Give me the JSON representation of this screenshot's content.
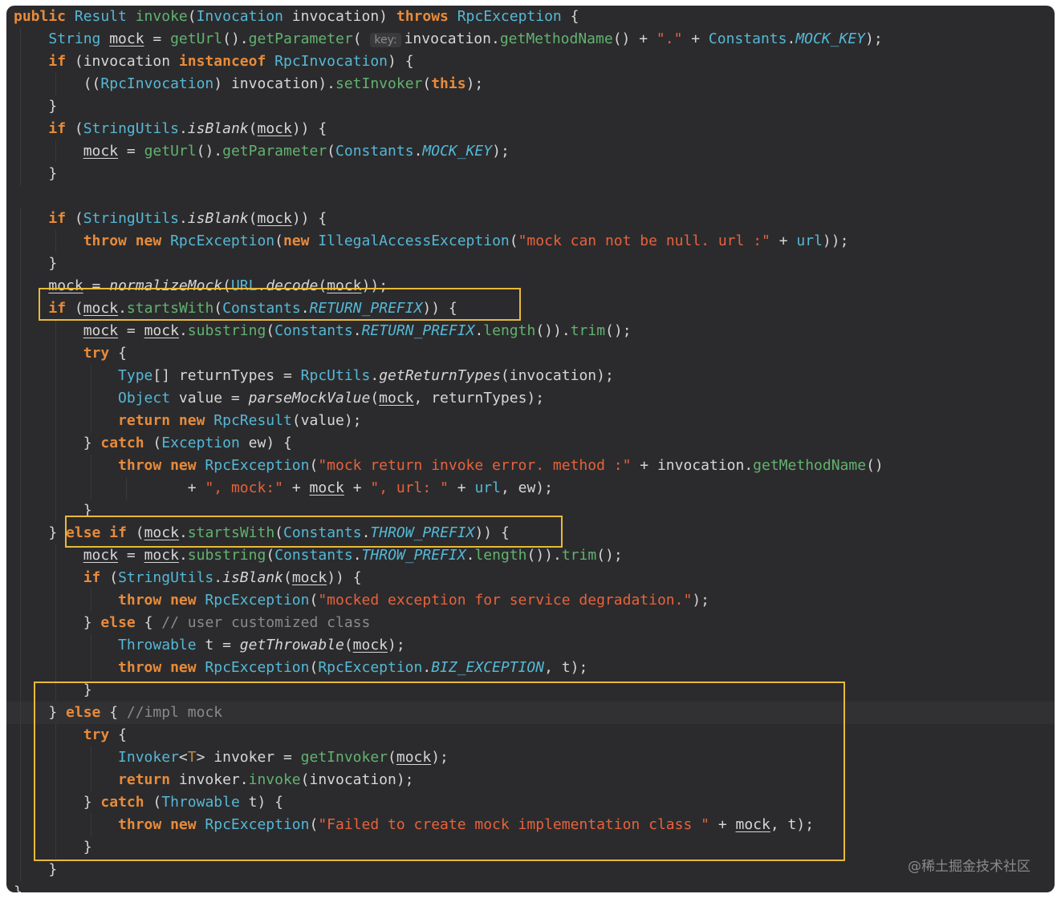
{
  "colors": {
    "keyword": "#e88b3a",
    "type": "#55b8d6",
    "method": "#62b26f",
    "string": "#e8623b",
    "comment": "#8a8a8a",
    "text": "#d6d6d6",
    "background": "#2b2b2d",
    "highlight_box": "#e8b93a"
  },
  "watermark": "@稀土掘金技术社区",
  "lines": [
    {
      "indent": 0,
      "tokens": [
        [
          "kw",
          "public "
        ],
        [
          "type",
          "Result "
        ],
        [
          "fn",
          "invoke"
        ],
        [
          "p",
          "("
        ],
        [
          "type",
          "Invocation"
        ],
        [
          "p",
          " invocation) "
        ],
        [
          "kw",
          "throws "
        ],
        [
          "type",
          "RpcException"
        ],
        [
          "p",
          " {"
        ]
      ]
    },
    {
      "indent": 1,
      "tokens": [
        [
          "type",
          "String "
        ],
        [
          "uvar",
          "mock"
        ],
        [
          "p",
          " = "
        ],
        [
          "fn",
          "getUrl"
        ],
        [
          "p",
          "()."
        ],
        [
          "fn",
          "getParameter"
        ],
        [
          "p",
          "( "
        ],
        [
          "hint",
          "key:"
        ],
        [
          "p",
          "invocation."
        ],
        [
          "fn",
          "getMethodName"
        ],
        [
          "p",
          "() + "
        ],
        [
          "str",
          "\".\""
        ],
        [
          "p",
          " + "
        ],
        [
          "type",
          "Constants"
        ],
        [
          "p",
          "."
        ],
        [
          "const",
          "MOCK_KEY"
        ],
        [
          "p",
          ");"
        ]
      ]
    },
    {
      "indent": 1,
      "tokens": [
        [
          "kw",
          "if "
        ],
        [
          "p",
          "(invocation "
        ],
        [
          "kw",
          "instanceof "
        ],
        [
          "type",
          "RpcInvocation"
        ],
        [
          "p",
          ") {"
        ]
      ]
    },
    {
      "indent": 2,
      "tokens": [
        [
          "p",
          "(("
        ],
        [
          "type",
          "RpcInvocation"
        ],
        [
          "p",
          ") invocation)."
        ],
        [
          "fn",
          "setInvoker"
        ],
        [
          "p",
          "("
        ],
        [
          "kw",
          "this"
        ],
        [
          "p",
          ");"
        ]
      ]
    },
    {
      "indent": 1,
      "tokens": [
        [
          "p",
          "}"
        ]
      ]
    },
    {
      "indent": 1,
      "tokens": [
        [
          "kw",
          "if "
        ],
        [
          "p",
          "("
        ],
        [
          "type",
          "StringUtils"
        ],
        [
          "p",
          "."
        ],
        [
          "ital",
          "isBlank"
        ],
        [
          "p",
          "("
        ],
        [
          "uvar",
          "mock"
        ],
        [
          "p",
          ")) {"
        ]
      ]
    },
    {
      "indent": 2,
      "tokens": [
        [
          "uvar",
          "mock"
        ],
        [
          "p",
          " = "
        ],
        [
          "fn",
          "getUrl"
        ],
        [
          "p",
          "()."
        ],
        [
          "fn",
          "getParameter"
        ],
        [
          "p",
          "("
        ],
        [
          "type",
          "Constants"
        ],
        [
          "p",
          "."
        ],
        [
          "const",
          "MOCK_KEY"
        ],
        [
          "p",
          ");"
        ]
      ]
    },
    {
      "indent": 1,
      "tokens": [
        [
          "p",
          "}"
        ]
      ]
    },
    {
      "indent": 0,
      "tokens": []
    },
    {
      "indent": 1,
      "tokens": [
        [
          "kw",
          "if "
        ],
        [
          "p",
          "("
        ],
        [
          "type",
          "StringUtils"
        ],
        [
          "p",
          "."
        ],
        [
          "ital",
          "isBlank"
        ],
        [
          "p",
          "("
        ],
        [
          "uvar",
          "mock"
        ],
        [
          "p",
          ")) {"
        ]
      ]
    },
    {
      "indent": 2,
      "tokens": [
        [
          "kw",
          "throw new "
        ],
        [
          "type",
          "RpcException"
        ],
        [
          "p",
          "("
        ],
        [
          "kw",
          "new "
        ],
        [
          "type",
          "IllegalAccessException"
        ],
        [
          "p",
          "("
        ],
        [
          "str",
          "\"mock can not be null. url :\""
        ],
        [
          "p",
          " + "
        ],
        [
          "type",
          "url"
        ],
        [
          "p",
          "));"
        ]
      ]
    },
    {
      "indent": 1,
      "tokens": [
        [
          "p",
          "}"
        ]
      ]
    },
    {
      "indent": 1,
      "tokens": [
        [
          "uvar",
          "mock"
        ],
        [
          "p",
          " = "
        ],
        [
          "ital",
          "normalizeMock"
        ],
        [
          "p",
          "("
        ],
        [
          "type",
          "URL"
        ],
        [
          "p",
          "."
        ],
        [
          "ital",
          "decode"
        ],
        [
          "p",
          "("
        ],
        [
          "uvar",
          "mock"
        ],
        [
          "p",
          "));"
        ]
      ]
    },
    {
      "indent": 1,
      "tokens": [
        [
          "kw",
          "if "
        ],
        [
          "p",
          "("
        ],
        [
          "uvar",
          "mock"
        ],
        [
          "p",
          "."
        ],
        [
          "fn",
          "startsWith"
        ],
        [
          "p",
          "("
        ],
        [
          "type",
          "Constants"
        ],
        [
          "p",
          "."
        ],
        [
          "const",
          "RETURN_PREFIX"
        ],
        [
          "p",
          ")) {"
        ]
      ]
    },
    {
      "indent": 2,
      "tokens": [
        [
          "uvar",
          "mock"
        ],
        [
          "p",
          " = "
        ],
        [
          "uvar",
          "mock"
        ],
        [
          "p",
          "."
        ],
        [
          "fn",
          "substring"
        ],
        [
          "p",
          "("
        ],
        [
          "type",
          "Constants"
        ],
        [
          "p",
          "."
        ],
        [
          "const",
          "RETURN_PREFIX"
        ],
        [
          "p",
          "."
        ],
        [
          "fn",
          "length"
        ],
        [
          "p",
          "())."
        ],
        [
          "fn",
          "trim"
        ],
        [
          "p",
          "();"
        ]
      ]
    },
    {
      "indent": 2,
      "tokens": [
        [
          "kw",
          "try "
        ],
        [
          "p",
          "{"
        ]
      ]
    },
    {
      "indent": 3,
      "tokens": [
        [
          "type",
          "Type"
        ],
        [
          "p",
          "[] returnTypes = "
        ],
        [
          "type",
          "RpcUtils"
        ],
        [
          "p",
          "."
        ],
        [
          "ital",
          "getReturnTypes"
        ],
        [
          "p",
          "(invocation);"
        ]
      ]
    },
    {
      "indent": 3,
      "tokens": [
        [
          "type",
          "Object "
        ],
        [
          "p",
          "value = "
        ],
        [
          "ital",
          "parseMockValue"
        ],
        [
          "p",
          "("
        ],
        [
          "uvar",
          "mock"
        ],
        [
          "p",
          ", returnTypes);"
        ]
      ]
    },
    {
      "indent": 3,
      "tokens": [
        [
          "kw",
          "return new "
        ],
        [
          "type",
          "RpcResult"
        ],
        [
          "p",
          "(value);"
        ]
      ]
    },
    {
      "indent": 2,
      "tokens": [
        [
          "p",
          "} "
        ],
        [
          "kw",
          "catch "
        ],
        [
          "p",
          "("
        ],
        [
          "type",
          "Exception"
        ],
        [
          "p",
          " ew) {"
        ]
      ]
    },
    {
      "indent": 3,
      "tokens": [
        [
          "kw",
          "throw new "
        ],
        [
          "type",
          "RpcException"
        ],
        [
          "p",
          "("
        ],
        [
          "str",
          "\"mock return invoke error. method :\""
        ],
        [
          "p",
          " + invocation."
        ],
        [
          "fn",
          "getMethodName"
        ],
        [
          "p",
          "()"
        ]
      ]
    },
    {
      "indent": 5,
      "tokens": [
        [
          "p",
          "+ "
        ],
        [
          "str",
          "\", mock:\""
        ],
        [
          "p",
          " + "
        ],
        [
          "uvar",
          "mock"
        ],
        [
          "p",
          " + "
        ],
        [
          "str",
          "\", url: \""
        ],
        [
          "p",
          " + "
        ],
        [
          "type",
          "url"
        ],
        [
          "p",
          ", ew);"
        ]
      ]
    },
    {
      "indent": 2,
      "tokens": [
        [
          "p",
          "}"
        ]
      ]
    },
    {
      "indent": 1,
      "tokens": [
        [
          "p",
          "} "
        ],
        [
          "kw",
          "else if "
        ],
        [
          "p",
          "("
        ],
        [
          "uvar",
          "mock"
        ],
        [
          "p",
          "."
        ],
        [
          "fn",
          "startsWith"
        ],
        [
          "p",
          "("
        ],
        [
          "type",
          "Constants"
        ],
        [
          "p",
          "."
        ],
        [
          "const",
          "THROW_PREFIX"
        ],
        [
          "p",
          ")) {"
        ]
      ]
    },
    {
      "indent": 2,
      "tokens": [
        [
          "uvar",
          "mock"
        ],
        [
          "p",
          " = "
        ],
        [
          "uvar",
          "mock"
        ],
        [
          "p",
          "."
        ],
        [
          "fn",
          "substring"
        ],
        [
          "p",
          "("
        ],
        [
          "type",
          "Constants"
        ],
        [
          "p",
          "."
        ],
        [
          "const",
          "THROW_PREFIX"
        ],
        [
          "p",
          "."
        ],
        [
          "fn",
          "length"
        ],
        [
          "p",
          "())."
        ],
        [
          "fn",
          "trim"
        ],
        [
          "p",
          "();"
        ]
      ]
    },
    {
      "indent": 2,
      "tokens": [
        [
          "kw",
          "if "
        ],
        [
          "p",
          "("
        ],
        [
          "type",
          "StringUtils"
        ],
        [
          "p",
          "."
        ],
        [
          "ital",
          "isBlank"
        ],
        [
          "p",
          "("
        ],
        [
          "uvar",
          "mock"
        ],
        [
          "p",
          ")) {"
        ]
      ]
    },
    {
      "indent": 3,
      "tokens": [
        [
          "kw",
          "throw new "
        ],
        [
          "type",
          "RpcException"
        ],
        [
          "p",
          "("
        ],
        [
          "str",
          "\"mocked exception for service degradation.\""
        ],
        [
          "p",
          ");"
        ]
      ]
    },
    {
      "indent": 2,
      "tokens": [
        [
          "p",
          "} "
        ],
        [
          "kw",
          "else "
        ],
        [
          "p",
          "{ "
        ],
        [
          "cmt",
          "// user customized class"
        ]
      ]
    },
    {
      "indent": 3,
      "tokens": [
        [
          "type",
          "Throwable "
        ],
        [
          "p",
          "t = "
        ],
        [
          "ital",
          "getThrowable"
        ],
        [
          "p",
          "("
        ],
        [
          "uvar",
          "mock"
        ],
        [
          "p",
          ");"
        ]
      ]
    },
    {
      "indent": 3,
      "tokens": [
        [
          "kw",
          "throw new "
        ],
        [
          "type",
          "RpcException"
        ],
        [
          "p",
          "("
        ],
        [
          "type",
          "RpcException"
        ],
        [
          "p",
          "."
        ],
        [
          "const",
          "BIZ_EXCEPTION"
        ],
        [
          "p",
          ", t);"
        ]
      ]
    },
    {
      "indent": 2,
      "tokens": [
        [
          "p",
          "}"
        ]
      ]
    },
    {
      "indent": 1,
      "current": true,
      "tokens": [
        [
          "p",
          "} "
        ],
        [
          "kw",
          "else "
        ],
        [
          "p",
          "{ "
        ],
        [
          "cmt",
          "//impl mock"
        ]
      ]
    },
    {
      "indent": 2,
      "tokens": [
        [
          "kw",
          "try "
        ],
        [
          "p",
          "{"
        ]
      ]
    },
    {
      "indent": 3,
      "tokens": [
        [
          "type",
          "Invoker"
        ],
        [
          "p",
          "<"
        ],
        [
          "gen",
          "T"
        ],
        [
          "p",
          "> invoker = "
        ],
        [
          "fn",
          "getInvoker"
        ],
        [
          "p",
          "("
        ],
        [
          "uvar",
          "mock"
        ],
        [
          "p",
          ");"
        ]
      ]
    },
    {
      "indent": 3,
      "tokens": [
        [
          "kw",
          "return "
        ],
        [
          "p",
          "invoker."
        ],
        [
          "fn",
          "invoke"
        ],
        [
          "p",
          "(invocation);"
        ]
      ]
    },
    {
      "indent": 2,
      "tokens": [
        [
          "p",
          "} "
        ],
        [
          "kw",
          "catch "
        ],
        [
          "p",
          "("
        ],
        [
          "type",
          "Throwable"
        ],
        [
          "p",
          " t) {"
        ]
      ]
    },
    {
      "indent": 3,
      "tokens": [
        [
          "kw",
          "throw new "
        ],
        [
          "type",
          "RpcException"
        ],
        [
          "p",
          "("
        ],
        [
          "str",
          "\"Failed to create mock implementation class \""
        ],
        [
          "p",
          " + "
        ],
        [
          "uvar",
          "mock"
        ],
        [
          "p",
          ", t);"
        ]
      ]
    },
    {
      "indent": 2,
      "tokens": [
        [
          "p",
          "}"
        ]
      ]
    },
    {
      "indent": 1,
      "tokens": [
        [
          "p",
          "}"
        ]
      ]
    },
    {
      "indent": 0,
      "tokens": [
        [
          "p",
          "}"
        ]
      ]
    }
  ]
}
